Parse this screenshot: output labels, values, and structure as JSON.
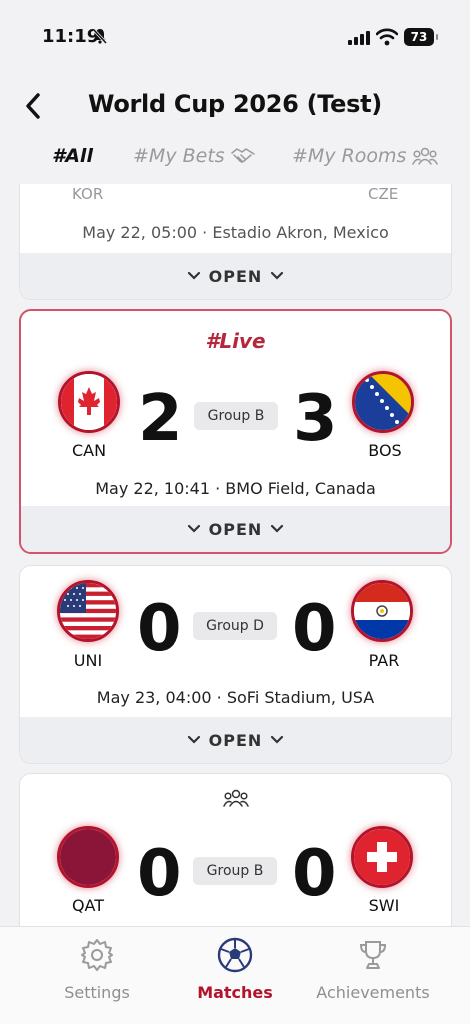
{
  "status_bar": {
    "time": "11:19",
    "battery": "73"
  },
  "header": {
    "title": "World Cup 2026 (Test)"
  },
  "tabs": [
    {
      "label": "#All"
    },
    {
      "label": "#My Bets"
    },
    {
      "label": "#My Rooms"
    }
  ],
  "matches": [
    {
      "home_code": "KOR",
      "away_code": "CZE",
      "meta": "May 22, 05:00 · Estadio Akron, Mexico",
      "open_label": "OPEN"
    },
    {
      "badge": "#Live",
      "home_code": "CAN",
      "home_score": "2",
      "away_code": "BOS",
      "away_score": "3",
      "group": "Group B",
      "meta": "May 22, 10:41 · BMO Field, Canada",
      "open_label": "OPEN"
    },
    {
      "home_code": "UNI",
      "home_score": "0",
      "away_code": "PAR",
      "away_score": "0",
      "group": "Group D",
      "meta": "May 23, 04:00 · SoFi Stadium, USA",
      "open_label": "OPEN"
    },
    {
      "home_code": "QAT",
      "home_score": "0",
      "away_code": "SWI",
      "away_score": "0",
      "group": "Group B"
    }
  ],
  "bottom_nav": [
    {
      "label": "Settings",
      "icon": "gear-icon"
    },
    {
      "label": "Matches",
      "icon": "soccer-ball-icon"
    },
    {
      "label": "Achievements",
      "icon": "trophy-icon"
    }
  ],
  "colors": {
    "accent": "#b3142b",
    "live_border": "#d0556a",
    "live_text": "#b4283e"
  }
}
